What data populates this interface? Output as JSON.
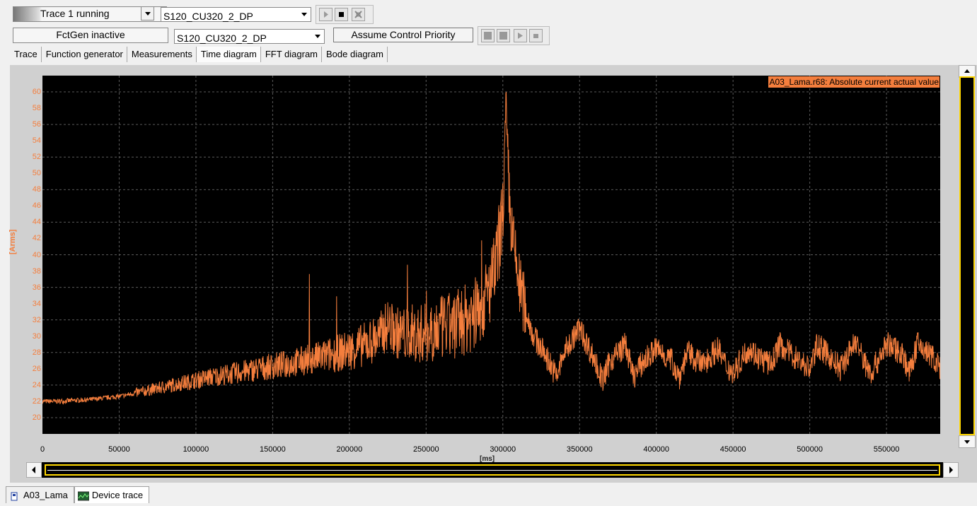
{
  "toolbar1": {
    "trace_status": "Trace 1 running",
    "device_select": "S120_CU320_2_DP"
  },
  "toolbar2": {
    "fctgen_status": "FctGen  inactive",
    "device_select": "S120_CU320_2_DP",
    "assume_control_label": "Assume Control Priority"
  },
  "tabs": [
    {
      "label": "Trace",
      "icon": "none"
    },
    {
      "label": "Function generator",
      "icon": "none"
    },
    {
      "label": "Measurements",
      "icon": "none"
    },
    {
      "label": "Time diagram",
      "icon": "none"
    },
    {
      "label": "FFT diagram",
      "icon": "none"
    },
    {
      "label": "Bode diagram",
      "icon": "none"
    }
  ],
  "chart_data": {
    "type": "line",
    "title": "",
    "xlabel": "[ms]",
    "ylabel": "[Arms]",
    "xlim": [
      0,
      585000
    ],
    "ylim": [
      18,
      62
    ],
    "xticks": [
      0,
      50000,
      100000,
      150000,
      200000,
      250000,
      300000,
      350000,
      400000,
      450000,
      500000,
      550000
    ],
    "yticks": [
      20,
      22,
      24,
      26,
      28,
      30,
      32,
      34,
      36,
      38,
      40,
      42,
      44,
      46,
      48,
      50,
      52,
      54,
      56,
      58,
      60
    ],
    "grid": true,
    "legend_position": "top-right",
    "series": [
      {
        "name": "A03_Lama.r68: Absolute current actual value",
        "color": "#f47e3d",
        "x": [
          0,
          10000,
          20000,
          30000,
          40000,
          50000,
          60000,
          70000,
          80000,
          90000,
          100000,
          110000,
          120000,
          130000,
          140000,
          150000,
          160000,
          170000,
          180000,
          190000,
          200000,
          210000,
          220000,
          225000,
          230000,
          240000,
          250000,
          260000,
          270000,
          280000,
          285000,
          290000,
          295000,
          300000,
          302000,
          305000,
          310000,
          315000,
          320000,
          330000,
          335000,
          340000,
          350000,
          360000,
          365000,
          370000,
          380000,
          385000,
          390000,
          400000,
          410000,
          415000,
          420000,
          430000,
          440000,
          445000,
          450000,
          460000,
          470000,
          475000,
          480000,
          490000,
          500000,
          505000,
          510000,
          520000,
          530000,
          535000,
          540000,
          550000,
          560000,
          565000,
          570000,
          580000,
          585000
        ],
        "y": [
          22.0,
          22.0,
          22.1,
          22.2,
          22.4,
          22.6,
          23.0,
          23.4,
          23.8,
          24.2,
          24.6,
          25.0,
          25.3,
          25.6,
          26.0,
          26.3,
          26.6,
          27.0,
          27.4,
          27.8,
          28.3,
          29.0,
          30.0,
          31.5,
          30.5,
          30.0,
          30.5,
          31.0,
          31.5,
          32.5,
          33.5,
          35.0,
          38.0,
          45.0,
          57.0,
          44.0,
          37.0,
          33.0,
          30.0,
          27.0,
          25.0,
          28.0,
          31.0,
          27.0,
          24.5,
          27.0,
          29.0,
          25.0,
          26.5,
          28.5,
          27.0,
          25.0,
          28.0,
          26.5,
          28.5,
          26.5,
          25.5,
          28.5,
          27.0,
          26.5,
          29.0,
          27.5,
          26.0,
          29.0,
          28.0,
          26.0,
          29.5,
          27.0,
          25.5,
          29.0,
          28.0,
          25.5,
          29.0,
          27.5,
          26.0
        ]
      }
    ]
  },
  "bottom_tabs": [
    {
      "label": "A03_Lama",
      "icon": "drive-icon"
    },
    {
      "label": "Device trace",
      "icon": "trace-icon"
    }
  ],
  "colors": {
    "trace": "#f47e3d",
    "plot_bg": "#000000",
    "grid": "#5a5a5a",
    "scroll_highlight": "#ffd700"
  }
}
